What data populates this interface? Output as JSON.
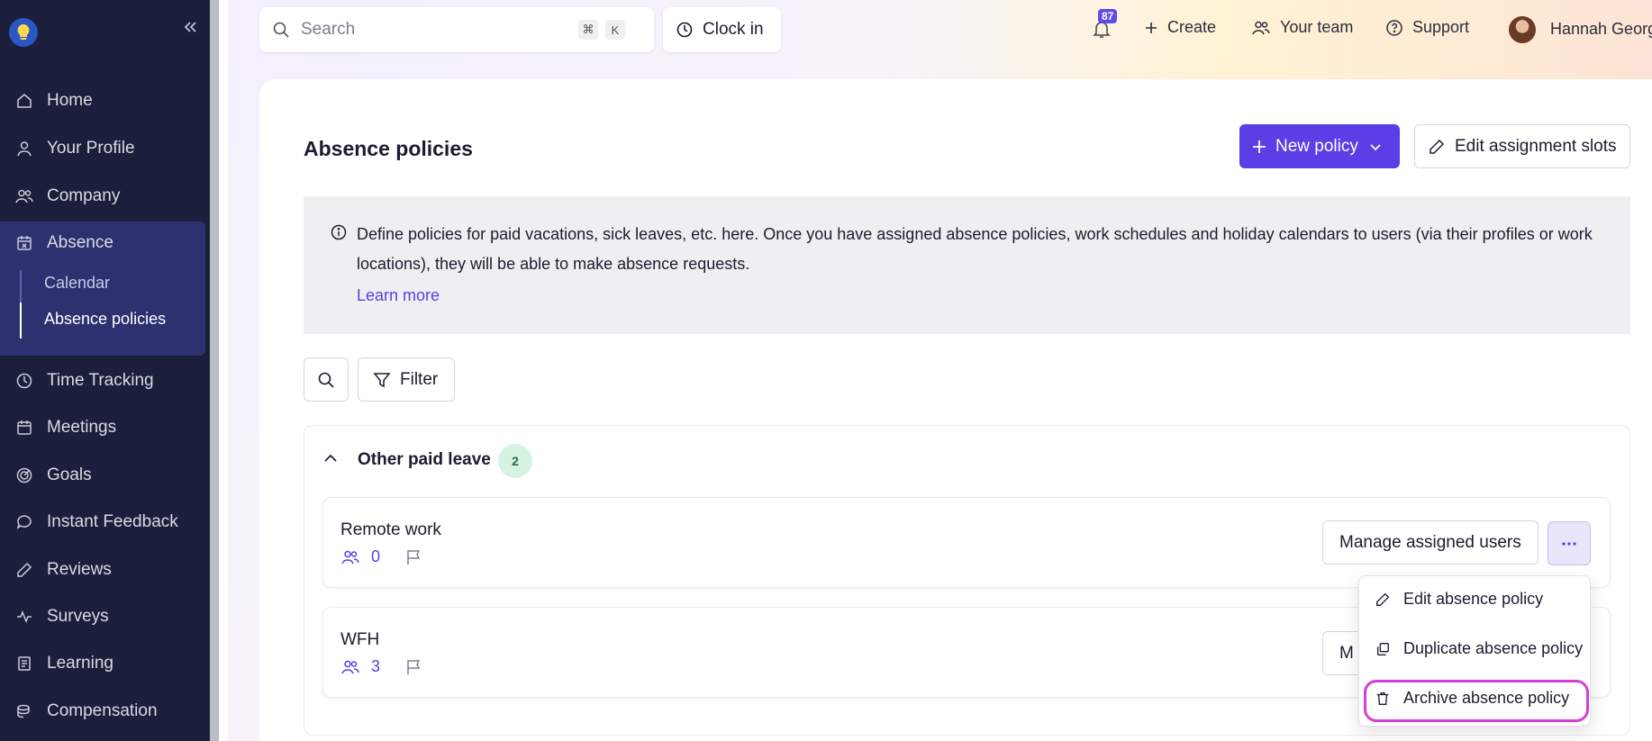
{
  "sidebar": {
    "collapse_label": "«",
    "items": [
      {
        "label": "Home",
        "icon": "home-icon"
      },
      {
        "label": "Your Profile",
        "icon": "user-icon"
      },
      {
        "label": "Company",
        "icon": "users-icon"
      },
      {
        "label": "Absence",
        "icon": "calendar-x-icon"
      },
      {
        "label": "Time Tracking",
        "icon": "clock-icon"
      },
      {
        "label": "Meetings",
        "icon": "calendar-icon"
      },
      {
        "label": "Goals",
        "icon": "target-icon"
      },
      {
        "label": "Instant Feedback",
        "icon": "chat-icon"
      },
      {
        "label": "Reviews",
        "icon": "pencil-icon"
      },
      {
        "label": "Surveys",
        "icon": "pulse-icon"
      },
      {
        "label": "Learning",
        "icon": "book-icon"
      },
      {
        "label": "Compensation",
        "icon": "coins-icon"
      }
    ],
    "absence_sub": [
      {
        "label": "Calendar",
        "active": false
      },
      {
        "label": "Absence policies",
        "active": true
      }
    ]
  },
  "topbar": {
    "search_placeholder": "Search",
    "kbd_cmd": "⌘",
    "kbd_k": "K",
    "clock_in": "Clock in",
    "notifications": "87",
    "create": "Create",
    "your_team": "Your team",
    "support": "Support",
    "user_name": "Hannah Georg"
  },
  "page": {
    "title": "Absence policies",
    "new_policy": "New policy",
    "edit_slots": "Edit assignment slots",
    "info_text": "Define policies for paid vacations, sick leaves, etc. here. Once you have assigned absence policies, work schedules and holiday calendars to users (via their profiles or work locations), they will be able to make absence requests.",
    "learn_more": "Learn more",
    "filter": "Filter"
  },
  "group": {
    "title": "Other paid leave",
    "count": "2",
    "policies": [
      {
        "name": "Remote work",
        "users": "0",
        "manage": "Manage assigned users"
      },
      {
        "name": "WFH",
        "users": "3",
        "manage": "M"
      }
    ]
  },
  "dropdown": {
    "items": [
      {
        "label": "Edit absence policy",
        "icon": "pencil-icon"
      },
      {
        "label": "Duplicate absence policy",
        "icon": "copy-icon"
      },
      {
        "label": "Archive absence policy",
        "icon": "trash-icon"
      }
    ]
  },
  "colors": {
    "sidebar_bg": "#1b1f3b",
    "active_group_bg": "#2d3170",
    "accent": "#5b3ee6",
    "count_badge_bg": "#d6f3e2",
    "highlight": "#d63fd6"
  }
}
